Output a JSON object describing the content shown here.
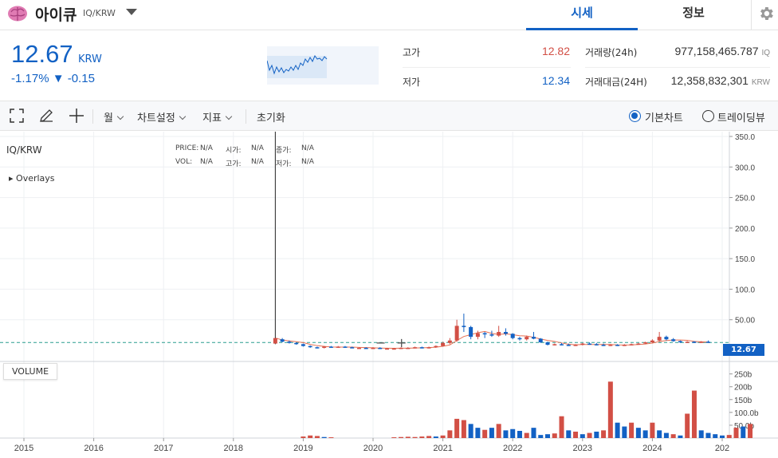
{
  "header": {
    "coin_name": "아이큐",
    "pair": "IQ/KRW",
    "tabs": [
      {
        "label": "시세",
        "active": true
      },
      {
        "label": "정보",
        "active": false
      }
    ]
  },
  "summary": {
    "price": "12.67",
    "unit": "KRW",
    "change_pct": "-1.17%",
    "change_abs": "▼ -0.15",
    "high_label": "고가",
    "high": "12.82",
    "low_label": "저가",
    "low": "12.34",
    "volume_label": "거래량(24h)",
    "volume": "977,158,465.787",
    "volume_unit": "IQ",
    "amount_label": "거래대금(24H)",
    "amount": "12,358,832,301",
    "amount_unit": "KRW"
  },
  "toolbar": {
    "period": "월",
    "chart_settings": "차트설정",
    "indicators": "지표",
    "reset": "초기화",
    "basic_chart": "기본차트",
    "trading_view": "트레이딩뷰"
  },
  "chart_overlay": {
    "pair": "IQ/KRW",
    "overlays": "Overlays",
    "volume_btn": "VOLUME",
    "last_price": "12.67",
    "ohlc": [
      {
        "k": "PRICE:",
        "v": "N/A"
      },
      {
        "k": "시가:",
        "v": "N/A"
      },
      {
        "k": "종가:",
        "v": "N/A"
      },
      {
        "k": "VOL:",
        "v": "N/A"
      },
      {
        "k": "고가:",
        "v": "N/A"
      },
      {
        "k": "저가:",
        "v": "N/A"
      }
    ]
  },
  "colors": {
    "up": "#d24f45",
    "down": "#1261c4",
    "accent": "#1261c4"
  },
  "chart_data": {
    "type": "candlestick",
    "y_ticks": [
      "350.0",
      "300.0",
      "250.0",
      "200.0",
      "150.0",
      "100.0",
      "50.00"
    ],
    "ylim": [
      0,
      350
    ],
    "x_ticks": [
      "2015",
      "2016",
      "2017",
      "2018",
      "2019",
      "2020",
      "2021",
      "2022",
      "2023",
      "2024",
      "202"
    ],
    "vol_ticks": [
      "250b",
      "200b",
      "150b",
      "100.0b",
      "50.0b"
    ],
    "vol_lim": [
      0,
      280
    ],
    "grid": true,
    "candles": [
      {
        "t": 2018.6,
        "o": 11,
        "h": 360,
        "l": 10,
        "c": 20
      },
      {
        "t": 2018.7,
        "o": 18,
        "h": 20,
        "l": 13,
        "c": 14
      },
      {
        "t": 2018.8,
        "o": 14,
        "h": 16,
        "l": 11,
        "c": 12
      },
      {
        "t": 2018.9,
        "o": 12,
        "h": 13,
        "l": 9,
        "c": 10
      },
      {
        "t": 2019.0,
        "o": 10,
        "h": 11,
        "l": 6,
        "c": 7
      },
      {
        "t": 2019.1,
        "o": 7,
        "h": 8,
        "l": 4,
        "c": 5
      },
      {
        "t": 2019.2,
        "o": 5,
        "h": 6,
        "l": 3,
        "c": 4
      },
      {
        "t": 2019.3,
        "o": 4,
        "h": 7,
        "l": 3,
        "c": 6
      },
      {
        "t": 2019.4,
        "o": 6,
        "h": 7,
        "l": 4,
        "c": 5
      },
      {
        "t": 2019.5,
        "o": 5,
        "h": 7,
        "l": 4,
        "c": 6
      },
      {
        "t": 2019.6,
        "o": 6,
        "h": 7,
        "l": 4,
        "c": 5
      },
      {
        "t": 2019.7,
        "o": 5,
        "h": 6,
        "l": 4,
        "c": 4
      },
      {
        "t": 2019.8,
        "o": 4,
        "h": 5,
        "l": 3,
        "c": 4
      },
      {
        "t": 2019.9,
        "o": 4,
        "h": 5,
        "l": 3,
        "c": 3
      },
      {
        "t": 2020.0,
        "o": 3,
        "h": 5,
        "l": 3,
        "c": 4
      },
      {
        "t": 2020.1,
        "o": 4,
        "h": 5,
        "l": 2,
        "c": 3
      },
      {
        "t": 2020.2,
        "o": 3,
        "h": 4,
        "l": 2,
        "c": 3
      },
      {
        "t": 2020.3,
        "o": 3,
        "h": 4,
        "l": 2,
        "c": 3
      },
      {
        "t": 2020.4,
        "o": 3,
        "h": 5,
        "l": 2,
        "c": 4
      },
      {
        "t": 2020.5,
        "o": 4,
        "h": 5,
        "l": 3,
        "c": 4
      },
      {
        "t": 2020.6,
        "o": 4,
        "h": 6,
        "l": 3,
        "c": 5
      },
      {
        "t": 2020.7,
        "o": 5,
        "h": 6,
        "l": 3,
        "c": 4
      },
      {
        "t": 2020.8,
        "o": 4,
        "h": 6,
        "l": 3,
        "c": 5
      },
      {
        "t": 2020.9,
        "o": 5,
        "h": 8,
        "l": 4,
        "c": 7
      },
      {
        "t": 2021.0,
        "o": 7,
        "h": 14,
        "l": 6,
        "c": 12
      },
      {
        "t": 2021.1,
        "o": 12,
        "h": 20,
        "l": 10,
        "c": 16
      },
      {
        "t": 2021.2,
        "o": 16,
        "h": 50,
        "l": 14,
        "c": 40
      },
      {
        "t": 2021.3,
        "o": 40,
        "h": 60,
        "l": 30,
        "c": 38
      },
      {
        "t": 2021.4,
        "o": 38,
        "h": 40,
        "l": 18,
        "c": 22
      },
      {
        "t": 2021.5,
        "o": 22,
        "h": 32,
        "l": 18,
        "c": 28
      },
      {
        "t": 2021.6,
        "o": 28,
        "h": 30,
        "l": 20,
        "c": 26
      },
      {
        "t": 2021.7,
        "o": 26,
        "h": 32,
        "l": 22,
        "c": 24
      },
      {
        "t": 2021.8,
        "o": 24,
        "h": 40,
        "l": 22,
        "c": 30
      },
      {
        "t": 2021.9,
        "o": 30,
        "h": 36,
        "l": 24,
        "c": 27
      },
      {
        "t": 2022.0,
        "o": 27,
        "h": 28,
        "l": 18,
        "c": 20
      },
      {
        "t": 2022.1,
        "o": 20,
        "h": 22,
        "l": 16,
        "c": 18
      },
      {
        "t": 2022.2,
        "o": 18,
        "h": 24,
        "l": 16,
        "c": 22
      },
      {
        "t": 2022.3,
        "o": 22,
        "h": 30,
        "l": 18,
        "c": 19
      },
      {
        "t": 2022.4,
        "o": 19,
        "h": 20,
        "l": 12,
        "c": 13
      },
      {
        "t": 2022.5,
        "o": 13,
        "h": 14,
        "l": 8,
        "c": 9
      },
      {
        "t": 2022.6,
        "o": 9,
        "h": 11,
        "l": 8,
        "c": 10
      },
      {
        "t": 2022.7,
        "o": 10,
        "h": 12,
        "l": 8,
        "c": 9
      },
      {
        "t": 2022.8,
        "o": 9,
        "h": 11,
        "l": 7,
        "c": 8
      },
      {
        "t": 2022.9,
        "o": 8,
        "h": 10,
        "l": 7,
        "c": 9
      },
      {
        "t": 2023.0,
        "o": 9,
        "h": 12,
        "l": 8,
        "c": 11
      },
      {
        "t": 2023.1,
        "o": 11,
        "h": 13,
        "l": 9,
        "c": 10
      },
      {
        "t": 2023.2,
        "o": 10,
        "h": 12,
        "l": 8,
        "c": 9
      },
      {
        "t": 2023.3,
        "o": 9,
        "h": 11,
        "l": 7,
        "c": 8
      },
      {
        "t": 2023.4,
        "o": 8,
        "h": 10,
        "l": 7,
        "c": 9
      },
      {
        "t": 2023.5,
        "o": 9,
        "h": 10,
        "l": 7,
        "c": 8
      },
      {
        "t": 2023.6,
        "o": 8,
        "h": 10,
        "l": 7,
        "c": 9
      },
      {
        "t": 2023.7,
        "o": 9,
        "h": 11,
        "l": 8,
        "c": 10
      },
      {
        "t": 2023.8,
        "o": 10,
        "h": 12,
        "l": 9,
        "c": 11
      },
      {
        "t": 2023.9,
        "o": 11,
        "h": 14,
        "l": 10,
        "c": 13
      },
      {
        "t": 2024.0,
        "o": 13,
        "h": 18,
        "l": 12,
        "c": 16
      },
      {
        "t": 2024.1,
        "o": 16,
        "h": 30,
        "l": 14,
        "c": 22
      },
      {
        "t": 2024.2,
        "o": 22,
        "h": 24,
        "l": 16,
        "c": 18
      },
      {
        "t": 2024.3,
        "o": 18,
        "h": 20,
        "l": 14,
        "c": 15
      },
      {
        "t": 2024.4,
        "o": 15,
        "h": 16,
        "l": 12,
        "c": 13
      },
      {
        "t": 2024.5,
        "o": 13,
        "h": 15,
        "l": 12,
        "c": 14
      },
      {
        "t": 2024.6,
        "o": 14,
        "h": 15,
        "l": 12,
        "c": 13
      },
      {
        "t": 2024.7,
        "o": 13,
        "h": 15,
        "l": 12,
        "c": 14
      },
      {
        "t": 2024.8,
        "o": 14,
        "h": 16,
        "l": 12,
        "c": 13
      }
    ],
    "volume": [
      {
        "t": 2019.0,
        "v": 6,
        "up": true
      },
      {
        "t": 2019.1,
        "v": 10,
        "up": true
      },
      {
        "t": 2019.2,
        "v": 8,
        "up": true
      },
      {
        "t": 2019.3,
        "v": 4,
        "up": false
      },
      {
        "t": 2019.4,
        "v": 3,
        "up": true
      },
      {
        "t": 2020.3,
        "v": 3,
        "up": true
      },
      {
        "t": 2020.4,
        "v": 4,
        "up": true
      },
      {
        "t": 2020.5,
        "v": 5,
        "up": true
      },
      {
        "t": 2020.6,
        "v": 4,
        "up": true
      },
      {
        "t": 2020.7,
        "v": 6,
        "up": true
      },
      {
        "t": 2020.8,
        "v": 8,
        "up": true
      },
      {
        "t": 2020.9,
        "v": 6,
        "up": false
      },
      {
        "t": 2021.0,
        "v": 10,
        "up": true
      },
      {
        "t": 2021.1,
        "v": 30,
        "up": true
      },
      {
        "t": 2021.2,
        "v": 75,
        "up": true
      },
      {
        "t": 2021.3,
        "v": 70,
        "up": true
      },
      {
        "t": 2021.4,
        "v": 55,
        "up": false
      },
      {
        "t": 2021.5,
        "v": 40,
        "up": false
      },
      {
        "t": 2021.6,
        "v": 32,
        "up": true
      },
      {
        "t": 2021.7,
        "v": 40,
        "up": false
      },
      {
        "t": 2021.8,
        "v": 55,
        "up": true
      },
      {
        "t": 2021.9,
        "v": 30,
        "up": false
      },
      {
        "t": 2022.0,
        "v": 35,
        "up": false
      },
      {
        "t": 2022.1,
        "v": 28,
        "up": false
      },
      {
        "t": 2022.2,
        "v": 20,
        "up": true
      },
      {
        "t": 2022.3,
        "v": 40,
        "up": false
      },
      {
        "t": 2022.4,
        "v": 12,
        "up": false
      },
      {
        "t": 2022.5,
        "v": 15,
        "up": false
      },
      {
        "t": 2022.6,
        "v": 18,
        "up": true
      },
      {
        "t": 2022.7,
        "v": 85,
        "up": true
      },
      {
        "t": 2022.8,
        "v": 30,
        "up": false
      },
      {
        "t": 2022.9,
        "v": 25,
        "up": true
      },
      {
        "t": 2023.0,
        "v": 15,
        "up": false
      },
      {
        "t": 2023.1,
        "v": 20,
        "up": true
      },
      {
        "t": 2023.2,
        "v": 25,
        "up": false
      },
      {
        "t": 2023.3,
        "v": 30,
        "up": true
      },
      {
        "t": 2023.4,
        "v": 220,
        "up": true
      },
      {
        "t": 2023.5,
        "v": 60,
        "up": false
      },
      {
        "t": 2023.6,
        "v": 45,
        "up": false
      },
      {
        "t": 2023.7,
        "v": 60,
        "up": true
      },
      {
        "t": 2023.8,
        "v": 40,
        "up": false
      },
      {
        "t": 2023.9,
        "v": 30,
        "up": false
      },
      {
        "t": 2024.0,
        "v": 60,
        "up": true
      },
      {
        "t": 2024.1,
        "v": 30,
        "up": false
      },
      {
        "t": 2024.2,
        "v": 20,
        "up": false
      },
      {
        "t": 2024.3,
        "v": 15,
        "up": true
      },
      {
        "t": 2024.4,
        "v": 10,
        "up": false
      },
      {
        "t": 2024.5,
        "v": 95,
        "up": true
      },
      {
        "t": 2024.6,
        "v": 185,
        "up": true
      },
      {
        "t": 2024.7,
        "v": 30,
        "up": false
      },
      {
        "t": 2024.8,
        "v": 20,
        "up": false
      },
      {
        "t": 2024.9,
        "v": 15,
        "up": false
      },
      {
        "t": 2025.0,
        "v": 10,
        "up": false
      },
      {
        "t": 2025.1,
        "v": 12,
        "up": true
      },
      {
        "t": 2025.2,
        "v": 40,
        "up": true
      },
      {
        "t": 2025.3,
        "v": 45,
        "up": false
      },
      {
        "t": 2025.4,
        "v": 55,
        "up": true
      }
    ]
  }
}
